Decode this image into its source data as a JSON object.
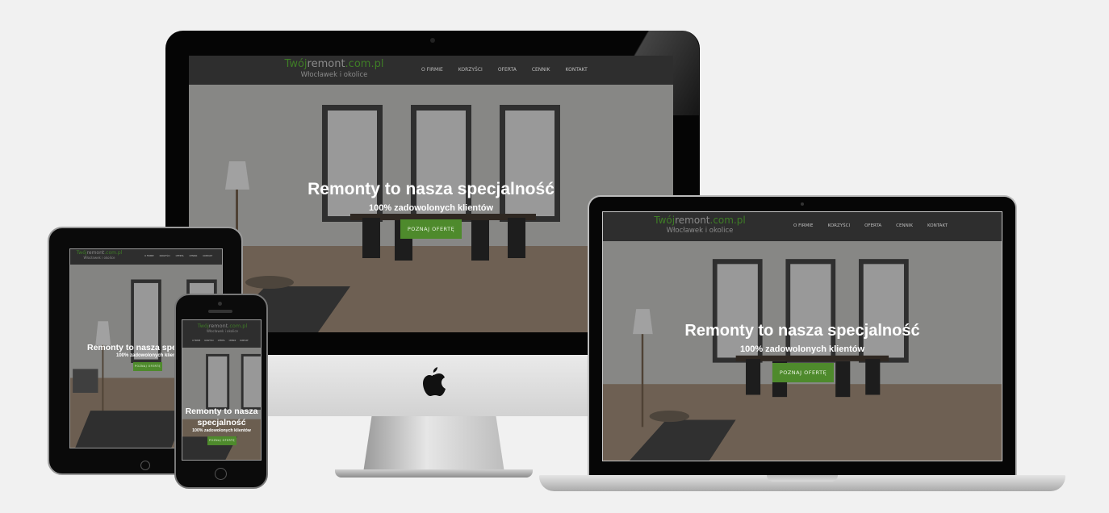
{
  "site": {
    "logo_part1": "Twój",
    "logo_part2": "remont",
    "logo_part3": ".com.pl",
    "logo_sub": "Włocławek i okolice",
    "nav": [
      "O FIRMIE",
      "KORZYŚCI",
      "OFERTA",
      "CENNIK",
      "KONTAKT"
    ],
    "headline": "Remonty to nasza specjalność",
    "headline_line1": "Remonty to nasza",
    "headline_line2": "specjalność",
    "subheadline": "100% zadowolonych klientów",
    "cta": "POZNAJ OFERTĘ",
    "headline_cropped": "Remonty to nasza spe",
    "subheadline_cropped": "100% zadowolonych klient"
  },
  "colors": {
    "accent": "#4e8a2c",
    "logo_green": "#3f7d26",
    "nav_bg": "#2e2e2e",
    "page_bg": "#f1f1f1"
  },
  "icons": {
    "imac_logo": "apple-logo-icon"
  }
}
